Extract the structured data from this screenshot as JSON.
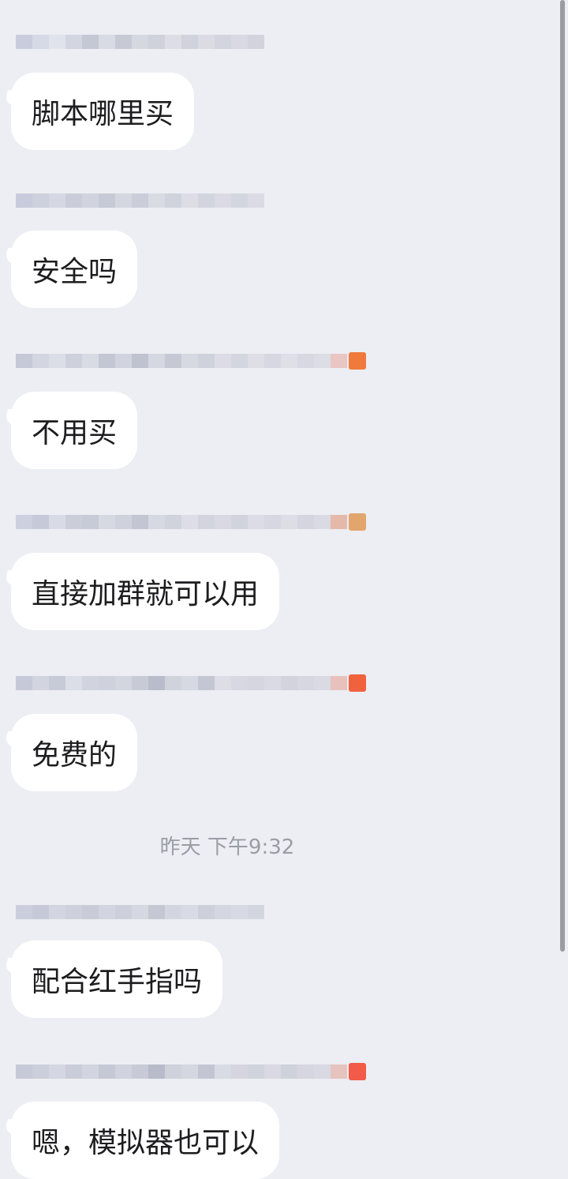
{
  "messages": [
    {
      "text": "脚本哪里买"
    },
    {
      "text": "安全吗"
    },
    {
      "text": "不用买"
    },
    {
      "text": "直接加群就可以用"
    },
    {
      "text": "免费的"
    },
    {
      "text": "配合红手指吗"
    },
    {
      "text": "嗯，模拟器也可以"
    }
  ],
  "timestamp": "昨天 下午9:32",
  "colors": {
    "background": "#eceef3",
    "bubble": "#ffffff",
    "text": "#1d1d1f",
    "timestamp": "#9a9da6"
  }
}
